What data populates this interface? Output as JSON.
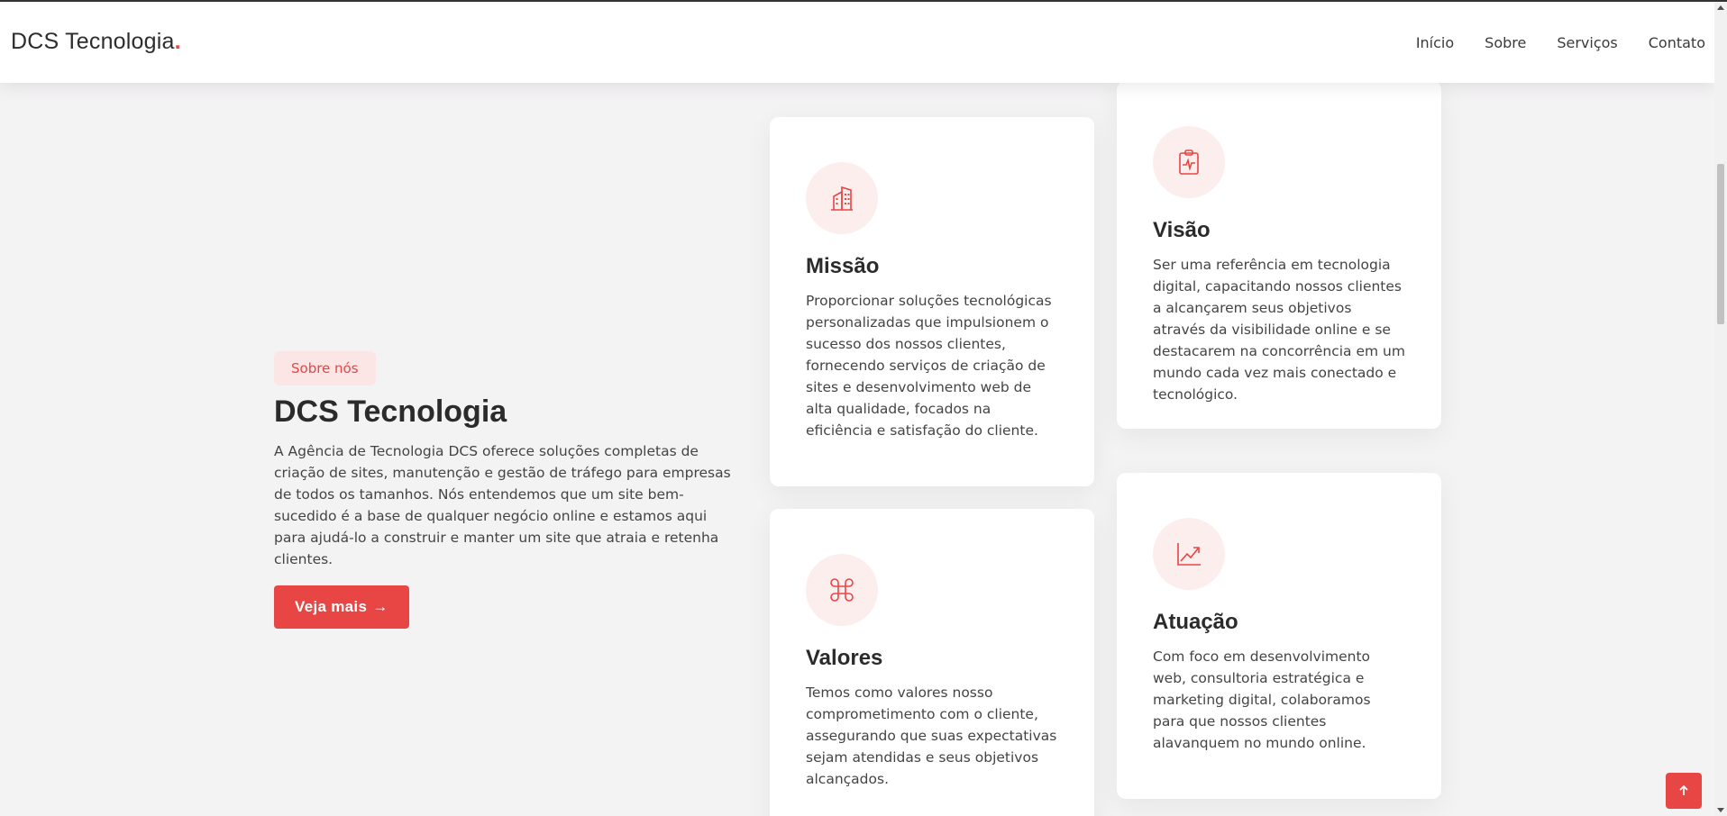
{
  "header": {
    "logo_text": "DCS Tecnologia",
    "logo_dot": ".",
    "nav": [
      {
        "label": "Início"
      },
      {
        "label": "Sobre"
      },
      {
        "label": "Serviços"
      },
      {
        "label": "Contato"
      }
    ]
  },
  "about": {
    "badge": "Sobre nós",
    "title": "DCS Tecnologia",
    "description": "A Agência de Tecnologia DCS oferece soluções completas de criação de sites, manutenção e gestão de tráfego para empresas de todos os tamanhos. Nós entendemos que um site bem-sucedido é a base de qualquer negócio online e estamos aqui para ajudá-lo a construir e manter um site que atraia e retenha clientes.",
    "button_label": "Veja mais",
    "button_arrow": "→"
  },
  "cards": {
    "missao": {
      "title": "Missão",
      "icon": "building-icon",
      "text": "Proporcionar soluções tecnológicas personalizadas que impulsionem o sucesso dos nossos clientes, fornecendo serviços de criação de sites e desenvolvimento web de alta qualidade, focados na eficiência e satisfação do cliente."
    },
    "visao": {
      "title": "Visão",
      "icon": "clipboard-pulse-icon",
      "text": "Ser uma referência em tecnologia digital, capacitando nossos clientes a alcançarem seus objetivos através da visibilidade online e se destacarem na concorrência em um mundo cada vez mais conectado e tecnológico."
    },
    "valores": {
      "title": "Valores",
      "icon": "command-icon",
      "text": "Temos como valores nosso comprometimento com o cliente, assegurando que suas expectativas sejam atendidas e seus objetivos alcançados."
    },
    "atuacao": {
      "title": "Atuação",
      "icon": "graph-up-arrow-icon",
      "text": "Com foco em desenvolvimento web, consultoria estratégica e marketing digital, colaboramos para que nossos clientes alavanquem no mundo online."
    }
  },
  "colors": {
    "accent": "#e84545",
    "accent_light": "#fdeeee",
    "badge_bg": "#fbe5e5",
    "background": "#f4f3f4",
    "text": "#2b2b2b"
  }
}
